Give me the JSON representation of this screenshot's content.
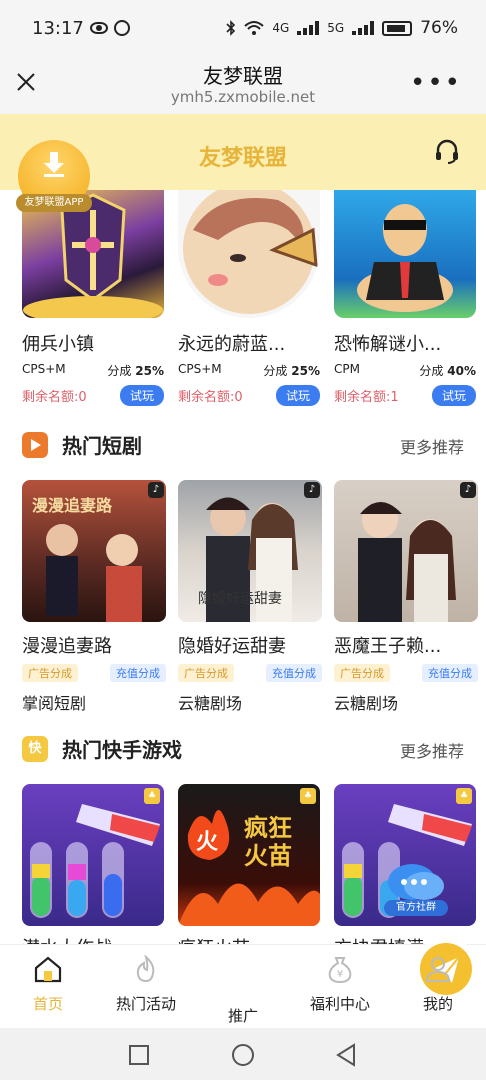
{
  "status_bar": {
    "time": "13:17",
    "battery": "76%",
    "network_4g": "4G",
    "network_5g": "5G"
  },
  "nav": {
    "title": "友梦联盟",
    "url": "ymh5.zxmobile.net",
    "more": "•••"
  },
  "banner": {
    "title": "友梦联盟",
    "app_label": "友梦联盟APP"
  },
  "games": [
    {
      "name": "佣兵小镇",
      "type": "CPS+M",
      "share_label": "分成",
      "share": "25%",
      "quota_label": "剩余名额:",
      "quota": "0",
      "try": "试玩"
    },
    {
      "name": "永远的蔚蓝...",
      "type": "CPS+M",
      "share_label": "分成",
      "share": "25%",
      "quota_label": "剩余名额:",
      "quota": "0",
      "try": "试玩"
    },
    {
      "name": "恐怖解谜小...",
      "type": "CPM",
      "share_label": "分成",
      "share": "40%",
      "quota_label": "剩余名额:",
      "quota": "1",
      "try": "试玩"
    }
  ],
  "drama_section": {
    "title": "热门短剧",
    "more": "更多推荐"
  },
  "dramas": [
    {
      "name": "漫漫追妻路",
      "tag_ad": "广告分成",
      "tag_recharge": "充值分成",
      "source": "掌阅短剧",
      "poster_text": "漫漫追妻路"
    },
    {
      "name": "隐婚好运甜妻",
      "tag_ad": "广告分成",
      "tag_recharge": "充值分成",
      "source": "云糖剧场",
      "poster_text": "隐婚好运甜妻"
    },
    {
      "name": "恶魔王子赖...",
      "tag_ad": "广告分成",
      "tag_recharge": "充值分成",
      "source": "云糖剧场",
      "poster_text": ""
    }
  ],
  "ks_section": {
    "title": "热门快手游戏",
    "more": "更多推荐",
    "icon_text": "快"
  },
  "ks_games": [
    {
      "name": "潜水大作战",
      "poster_text": ""
    },
    {
      "name": "疯狂火苗",
      "poster_text": "疯狂火苗",
      "fire_char": "火"
    },
    {
      "name": "方块君填满",
      "poster_text": ""
    }
  ],
  "community": {
    "label": "官方社群"
  },
  "tabbar": [
    {
      "label": "首页",
      "icon": "home-icon",
      "active": true
    },
    {
      "label": "热门活动",
      "icon": "flame-icon",
      "active": false
    },
    {
      "label": "推广",
      "icon": "paper-plane-icon",
      "active": false
    },
    {
      "label": "福利中心",
      "icon": "money-bag-icon",
      "active": false
    },
    {
      "label": "我的",
      "icon": "user-icon",
      "active": false
    }
  ],
  "colors": {
    "brand_yellow": "#e7b43a",
    "banner_bg": "#fcefb4",
    "try_blue": "#3b7cf0",
    "quota_red": "#e0606a"
  }
}
